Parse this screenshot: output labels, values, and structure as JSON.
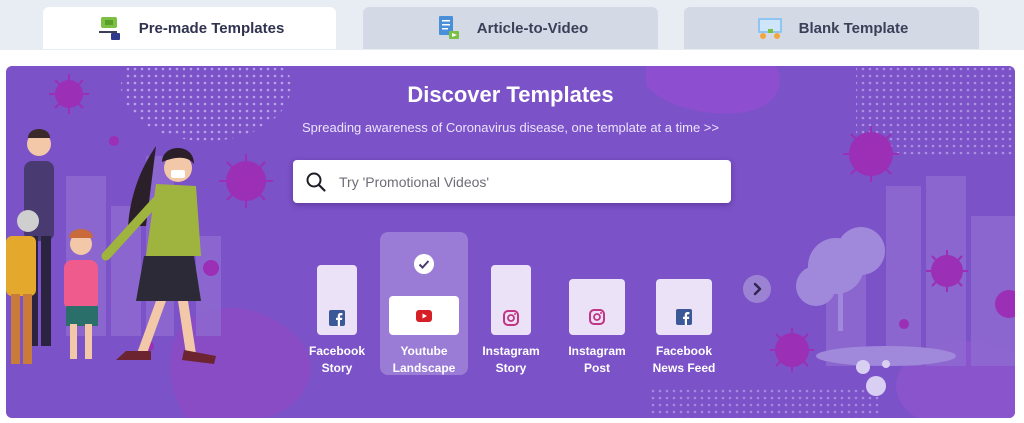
{
  "tabs": [
    {
      "label": "Pre-made Templates",
      "icon": "presentation-icon",
      "active": true
    },
    {
      "label": "Article-to-Video",
      "icon": "document-video-icon",
      "active": false
    },
    {
      "label": "Blank Template",
      "icon": "blank-screen-icon",
      "active": false
    }
  ],
  "hero": {
    "title": "Discover Templates",
    "subtitle": "Spreading awareness of Coronavirus disease, one template at a time >>",
    "background_color": "#7b52c7"
  },
  "search": {
    "placeholder": "Try 'Promotional Videos'"
  },
  "templates": [
    {
      "line1": "Facebook",
      "line2": "Story",
      "icon": "facebook-icon",
      "selected": false
    },
    {
      "line1": "Youtube",
      "line2": "Landscape",
      "icon": "youtube-icon",
      "selected": true
    },
    {
      "line1": "Instagram",
      "line2": "Story",
      "icon": "instagram-icon",
      "selected": false
    },
    {
      "line1": "Instagram",
      "line2": "Post",
      "icon": "instagram-icon",
      "selected": false
    },
    {
      "line1": "Facebook",
      "line2": "News Feed",
      "icon": "facebook-icon",
      "selected": false
    }
  ],
  "colors": {
    "facebook": "#3b5998",
    "youtube": "#d61f26",
    "instagram": "#c13584",
    "virus": "#9b2fb5"
  }
}
